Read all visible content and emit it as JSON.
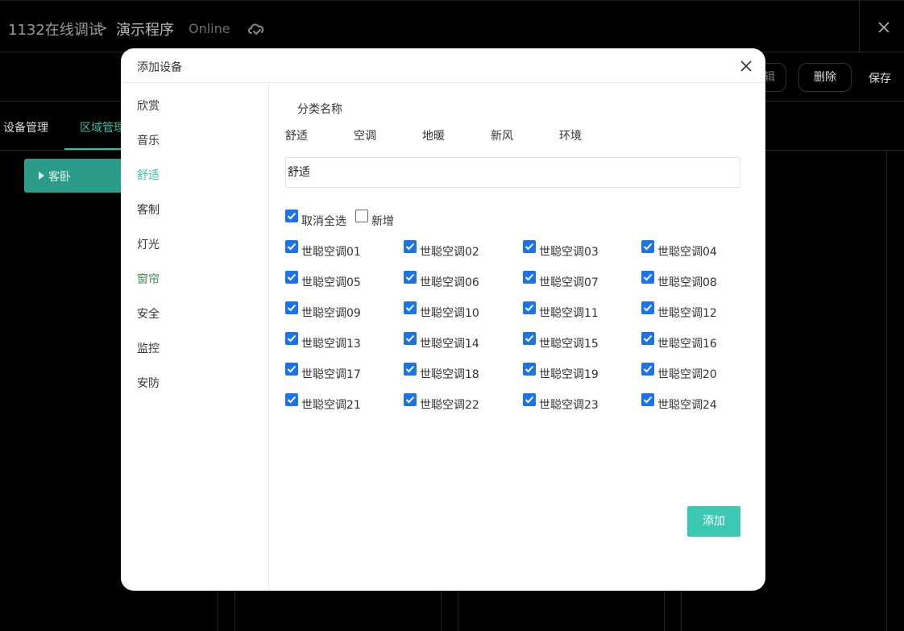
{
  "header": {
    "project": "1132在线调试",
    "separator": ">",
    "page": "演示程序",
    "status": "Online"
  },
  "toolbar": {
    "edit_label": "编辑",
    "delete_label": "删除",
    "save_label": "保存"
  },
  "tabs": [
    {
      "label": "设备管理"
    },
    {
      "label": "区域管理"
    }
  ],
  "room": {
    "label": "客卧"
  },
  "modal": {
    "title": "添加设备",
    "categories": [
      {
        "label": "欣赏"
      },
      {
        "label": "音乐"
      },
      {
        "label": "舒适"
      },
      {
        "label": "客制"
      },
      {
        "label": "灯光"
      },
      {
        "label": "窗帘"
      },
      {
        "label": "安全"
      },
      {
        "label": "监控"
      },
      {
        "label": "安防"
      }
    ],
    "category_name_label": "分类名称",
    "category_options": [
      {
        "label": "舒适"
      },
      {
        "label": "空调"
      },
      {
        "label": "地暖"
      },
      {
        "label": "新风"
      },
      {
        "label": "环境"
      }
    ],
    "name_input_value": "舒适",
    "deselect_all_label": "取消全选",
    "add_new_label": "新增",
    "devices": [
      {
        "label": "世聪空调01"
      },
      {
        "label": "世聪空调02"
      },
      {
        "label": "世聪空调03"
      },
      {
        "label": "世聪空调04"
      },
      {
        "label": "世聪空调05"
      },
      {
        "label": "世聪空调06"
      },
      {
        "label": "世聪空调07"
      },
      {
        "label": "世聪空调08"
      },
      {
        "label": "世聪空调09"
      },
      {
        "label": "世聪空调10"
      },
      {
        "label": "世聪空调11"
      },
      {
        "label": "世聪空调12"
      },
      {
        "label": "世聪空调13"
      },
      {
        "label": "世聪空调14"
      },
      {
        "label": "世聪空调15"
      },
      {
        "label": "世聪空调16"
      },
      {
        "label": "世聪空调17"
      },
      {
        "label": "世聪空调18"
      },
      {
        "label": "世聪空调19"
      },
      {
        "label": "世聪空调20"
      },
      {
        "label": "世聪空调21"
      },
      {
        "label": "世聪空调22"
      },
      {
        "label": "世聪空调23"
      },
      {
        "label": "世聪空调24"
      }
    ],
    "submit_label": "添加"
  },
  "colors": {
    "accent": "#3dbfa9",
    "checkbox": "#1a73e8",
    "add_button": "#3dc8b3"
  },
  "icons": {
    "cloud": "cloud-sync-icon",
    "close": "close-icon",
    "checkmark": "checkmark-icon"
  }
}
